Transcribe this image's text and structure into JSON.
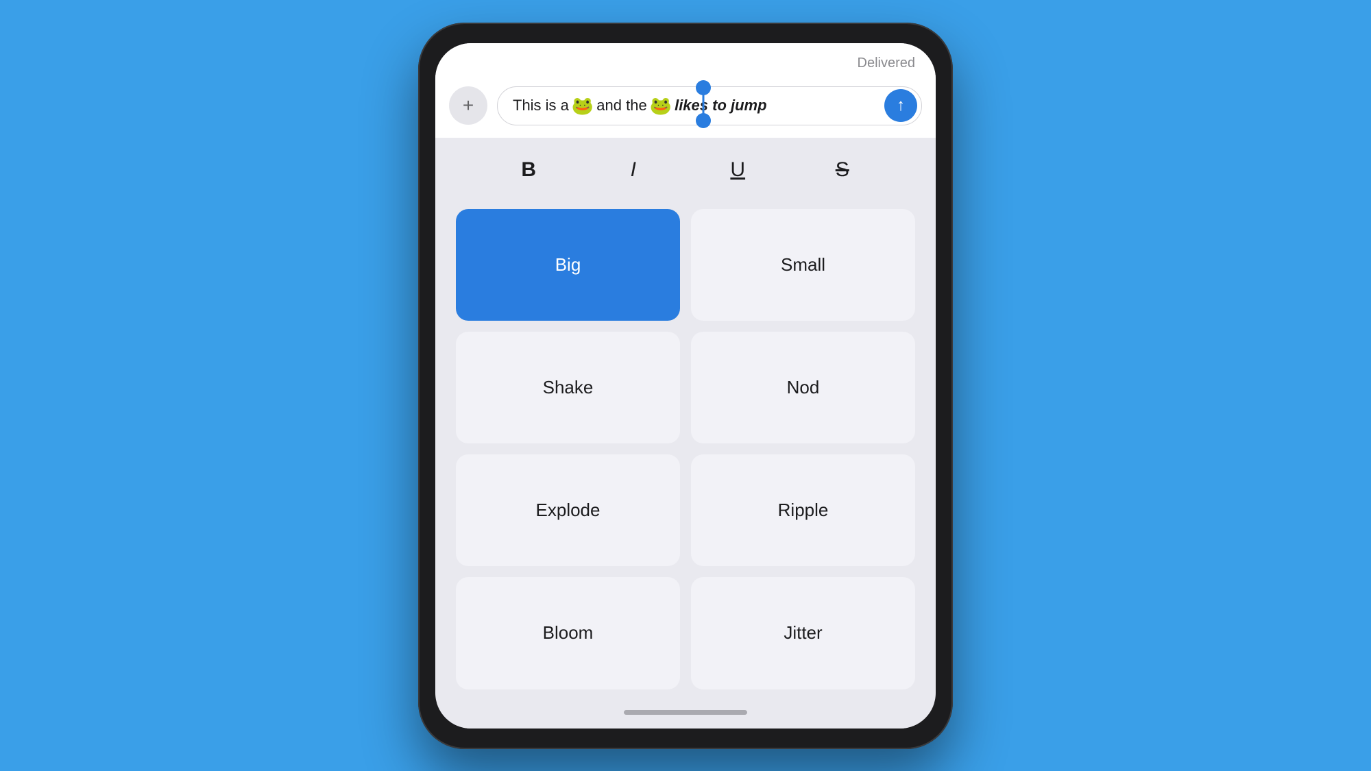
{
  "phone": {
    "delivered_label": "Delivered",
    "input": {
      "text_part1": "This is a",
      "frog1": "🐸",
      "text_part2": "and the",
      "frog2": "🐸",
      "text_italic": "likes to jump",
      "plus_label": "+",
      "send_aria": "Send"
    },
    "formatting": {
      "bold_label": "B",
      "italic_label": "I",
      "underline_label": "U",
      "strikethrough_label": "S"
    },
    "effects": [
      {
        "label": "Big",
        "active": true
      },
      {
        "label": "Small",
        "active": false
      },
      {
        "label": "Shake",
        "active": false
      },
      {
        "label": "Nod",
        "active": false
      },
      {
        "label": "Explode",
        "active": false
      },
      {
        "label": "Ripple",
        "active": false
      },
      {
        "label": "Bloom",
        "active": false
      },
      {
        "label": "Jitter",
        "active": false
      }
    ],
    "home_indicator": true
  },
  "colors": {
    "background": "#3a9fe8",
    "send_button": "#2a7ddf",
    "active_effect": "#2a7ddf",
    "screen_bg": "#e9e9ef"
  }
}
